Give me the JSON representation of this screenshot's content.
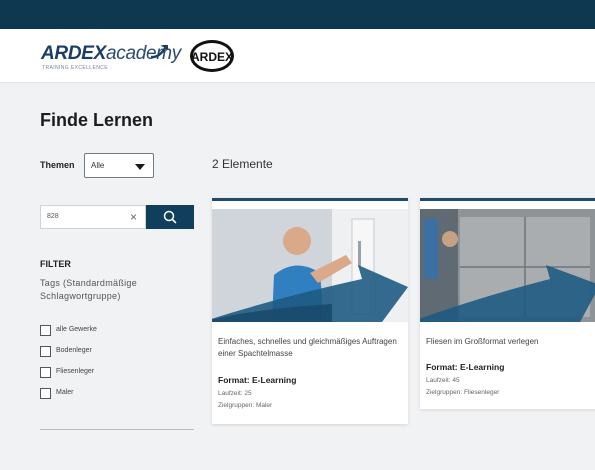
{
  "header": {
    "logo_main": "ARDEX",
    "logo_accent": "academy",
    "logo_sub": "TRAINING EXCELLENCE",
    "brand_badge": "ARDEX"
  },
  "page": {
    "title": "Finde Lernen"
  },
  "themen": {
    "label": "Themen",
    "selected": "Alle"
  },
  "results": {
    "count_text": "2 Elemente"
  },
  "search": {
    "value": "828",
    "clear_icon": "×",
    "button_icon": "search-icon"
  },
  "filter": {
    "title": "FILTER",
    "tags_label": "Tags (Standardmäßige Schlagwortgruppe)",
    "options": [
      "alle Gewerke",
      "Bodenleger",
      "Fliesenleger",
      "Maler"
    ]
  },
  "cards": [
    {
      "description": "Einfaches, schnelles und gleichmäßiges Auftragen einer Spachtelmasse",
      "format": "Format: E-Learning",
      "duration": "Laufzeit: 25",
      "audience": "Zielgruppen: Maler"
    },
    {
      "description": "Fliesen im Großformat verlegen",
      "format": "Format: E-Learning",
      "duration": "Laufzeit: 45",
      "audience": "Zielgruppen: Fliesenleger"
    }
  ],
  "colors": {
    "topbar": "#0e3750",
    "accent": "#0f3f5c",
    "card_arrow": "#1e5b82"
  }
}
